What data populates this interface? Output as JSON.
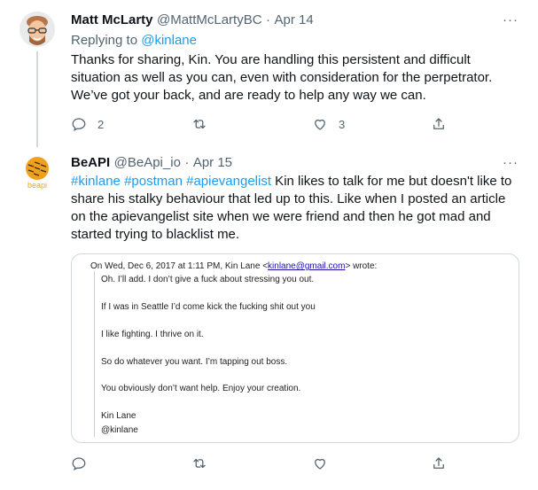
{
  "tweet1": {
    "display_name": "Matt McLarty",
    "handle": "@MattMcLartyBC",
    "separator": "·",
    "date": "Apr 14",
    "replying_prefix": "Replying to",
    "replying_handle": "@kinlane",
    "text": "Thanks for sharing, Kin. You are handling this persistent and difficult situation as well as you can, even with consideration for the perpetrator. We’ve got your back, and are ready to help any way we can.",
    "more": "···",
    "actions": {
      "reply_count": "2",
      "retweet_count": "",
      "like_count": "3"
    }
  },
  "tweet2": {
    "display_name": "BeAPI",
    "handle": "@BeApi_io",
    "separator": "·",
    "date": "Apr 15",
    "avatar_label": "beapi",
    "hashtags": [
      "#kinlane",
      "#postman",
      "#apievangelist"
    ],
    "text": " Kin likes to talk for me but doesn't like to share his stalky behaviour that led up to this. Like when I posted an article on the apievangelist site when we were friend and then he got mad and started trying to blacklist me.",
    "more": "···",
    "email": {
      "header_prefix": "On Wed, Dec 6, 2017 at 1:11 PM, Kin Lane <",
      "header_email": "kinlane@gmail.com",
      "header_suffix": "> wrote:",
      "lines": [
        "Oh. I’ll add. I don’t give a fuck about stressing you out.",
        "If I was in Seattle I’d come kick the fucking shit out you",
        "I like fighting. I thrive on it.",
        "So do whatever you want. I’m tapping out boss.",
        "You obviously don’t want help. Enjoy your creation.",
        "Kin Lane",
        "@kinlane"
      ]
    }
  },
  "colors": {
    "text": "#0f1419",
    "secondary": "#536471",
    "link": "#1d9bf0",
    "border": "#cfd9de",
    "beapi_orange": "#f0a11c"
  },
  "icons": [
    "more-icon",
    "reply-icon",
    "retweet-icon",
    "like-icon",
    "share-icon"
  ]
}
